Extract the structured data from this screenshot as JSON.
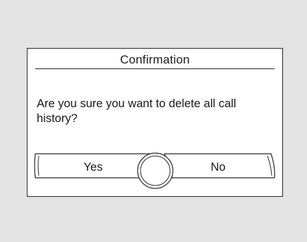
{
  "dialog": {
    "title": "Confirmation",
    "message": "Are you sure you want to delete all call history?",
    "buttons": {
      "yes_label": "Yes",
      "no_label": "No"
    }
  },
  "colors": {
    "background": "#e3e3e3",
    "dialog_background": "#ffffff",
    "line": "#2a2a2a",
    "text": "#1a1a1a"
  }
}
